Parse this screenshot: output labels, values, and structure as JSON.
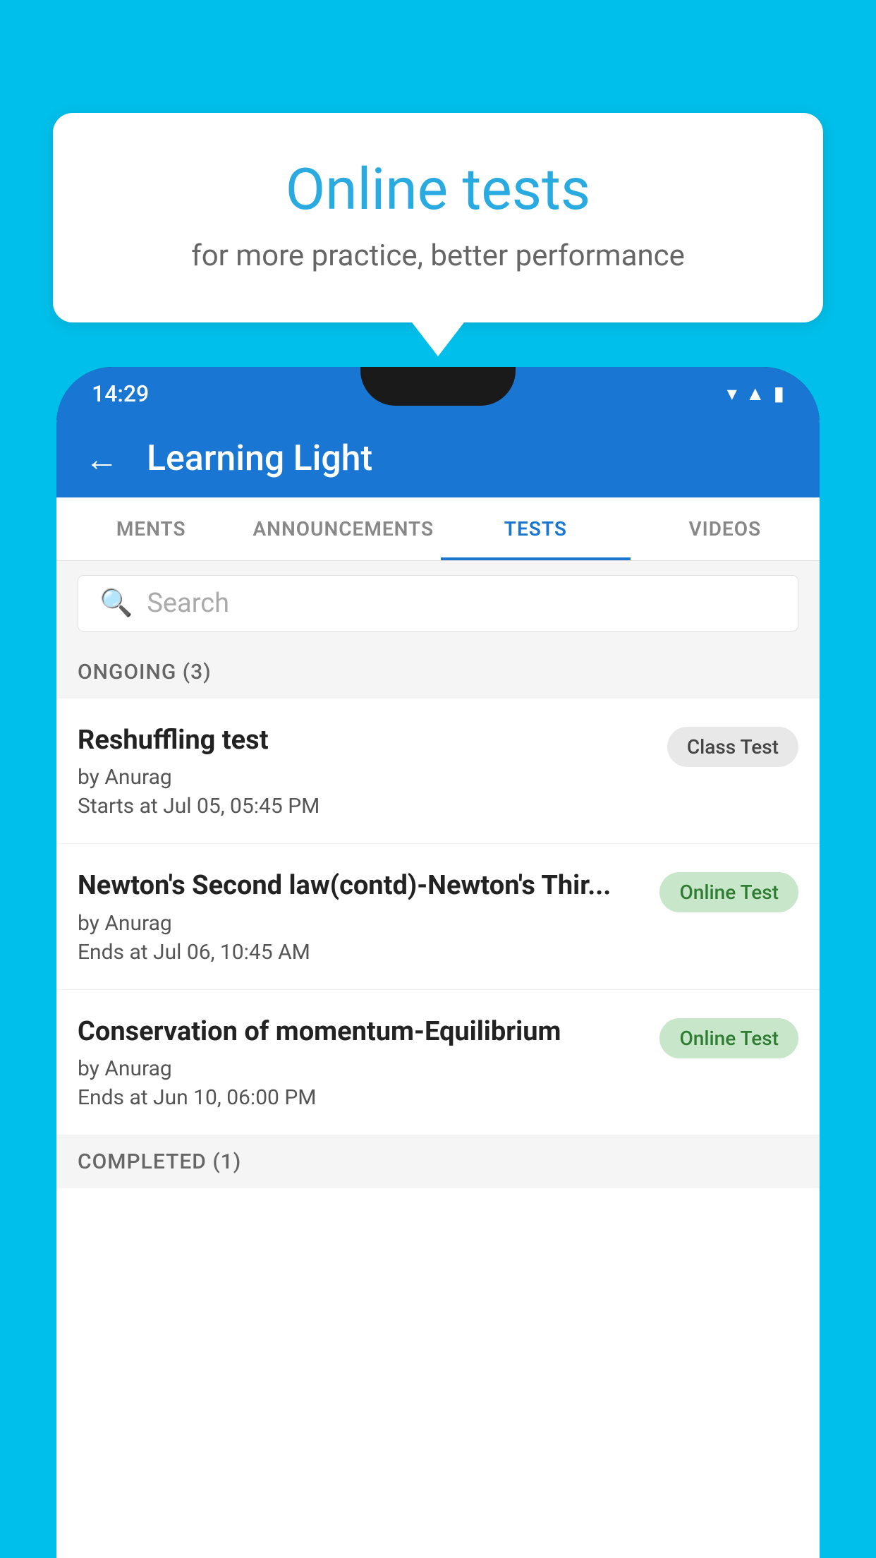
{
  "background_color": "#00BFEA",
  "speech_bubble": {
    "title": "Online tests",
    "subtitle": "for more practice, better performance"
  },
  "phone": {
    "status_bar": {
      "time": "14:29",
      "icons": [
        "wifi",
        "signal",
        "battery"
      ]
    },
    "app_bar": {
      "title": "Learning Light",
      "back_label": "←"
    },
    "tabs": [
      {
        "label": "MENTS",
        "active": false
      },
      {
        "label": "ANNOUNCEMENTS",
        "active": false
      },
      {
        "label": "TESTS",
        "active": true
      },
      {
        "label": "VIDEOS",
        "active": false
      }
    ],
    "search": {
      "placeholder": "Search"
    },
    "ongoing_section": {
      "label": "ONGOING (3)"
    },
    "tests": [
      {
        "name": "Reshuffling test",
        "author": "by Anurag",
        "date": "Starts at  Jul 05, 05:45 PM",
        "badge": "Class Test",
        "badge_type": "class"
      },
      {
        "name": "Newton's Second law(contd)-Newton's Thir...",
        "author": "by Anurag",
        "date": "Ends at  Jul 06, 10:45 AM",
        "badge": "Online Test",
        "badge_type": "online"
      },
      {
        "name": "Conservation of momentum-Equilibrium",
        "author": "by Anurag",
        "date": "Ends at  Jun 10, 06:00 PM",
        "badge": "Online Test",
        "badge_type": "online"
      }
    ],
    "completed_section": {
      "label": "COMPLETED (1)"
    }
  }
}
